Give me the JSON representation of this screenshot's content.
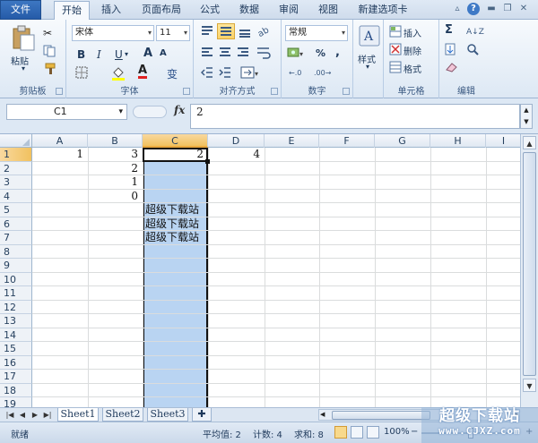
{
  "tabs": [
    "文件",
    "开始",
    "插入",
    "页面布局",
    "公式",
    "数据",
    "审阅",
    "视图",
    "新建选项卡"
  ],
  "ribbon": {
    "clipboard": {
      "label": "剪贴板",
      "paste": "粘贴"
    },
    "font": {
      "label": "字体",
      "name": "宋体",
      "size": "11",
      "bold": "B",
      "italic": "I",
      "underline": "U",
      "grow": "A",
      "shrink": "A",
      "color_a": "A",
      "phonetic": "变"
    },
    "align": {
      "label": "对齐方式"
    },
    "number": {
      "label": "数字",
      "format": "常规",
      "percent": "%",
      "comma": ","
    },
    "styles": {
      "label": "样式",
      "button": "样式"
    },
    "cells": {
      "label": "单元格",
      "insert": "插入",
      "delete": "删除",
      "format": "格式"
    },
    "editing": {
      "label": "编辑",
      "sum": "Σ"
    }
  },
  "formula_bar": {
    "name_box": "C1",
    "fx": "fx",
    "value": "2"
  },
  "columns": [
    "A",
    "B",
    "C",
    "D",
    "E",
    "F",
    "G",
    "H",
    "I"
  ],
  "rows": [
    "1",
    "2",
    "3",
    "4",
    "5",
    "6",
    "7",
    "8",
    "9",
    "10",
    "11",
    "12",
    "13",
    "14",
    "15",
    "16",
    "17",
    "18",
    "19"
  ],
  "cells": {
    "A1": "1",
    "B1": "3",
    "C1": "2",
    "D1": "4",
    "B2": "2",
    "B3": "1",
    "B4": "0",
    "C5": "超级下载站",
    "C6": "超级下载站",
    "C7": "超级下载站"
  },
  "sheets": [
    "Sheet1",
    "Sheet2",
    "Sheet3"
  ],
  "status": {
    "ready": "就绪",
    "average": "平均值: 2",
    "count": "计数: 4",
    "sum": "求和: 8",
    "zoom": "100%",
    "zoom_minus": "−",
    "zoom_plus": "+"
  },
  "watermark": {
    "title": "超级下载站",
    "url": "www.CJXZ.com"
  }
}
